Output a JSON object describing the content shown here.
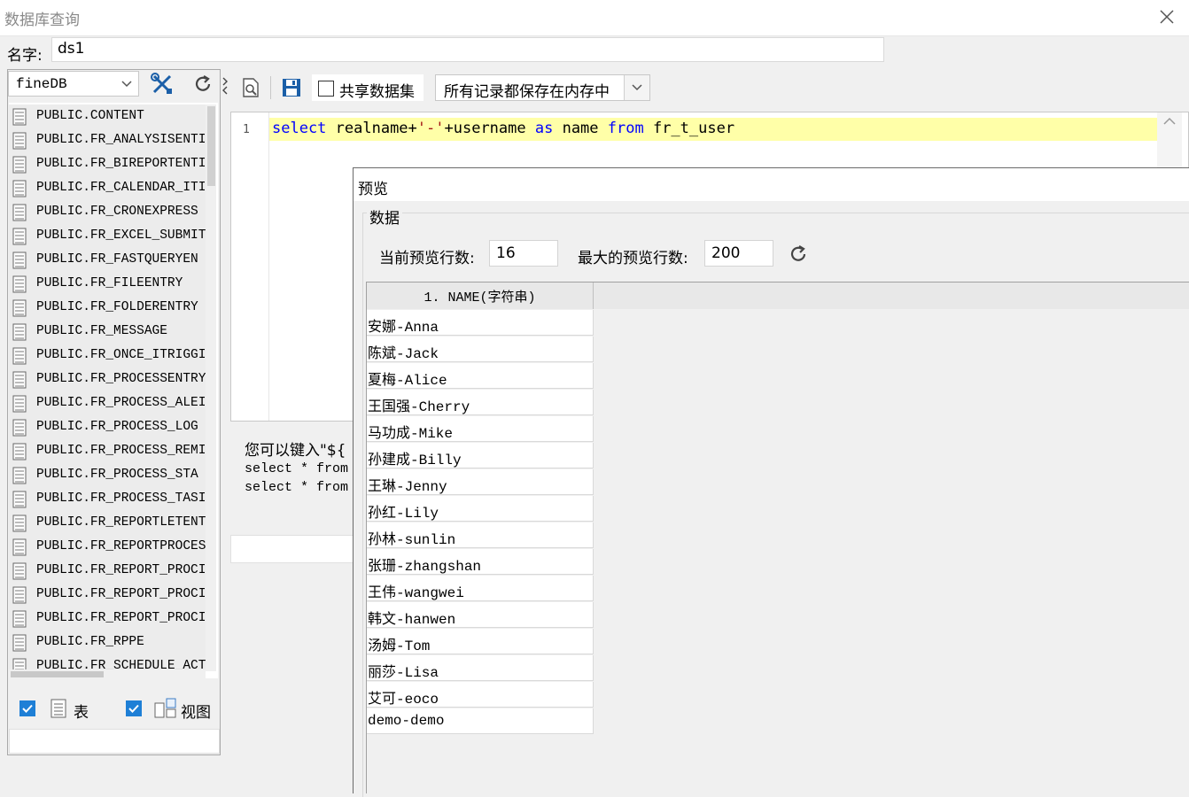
{
  "window": {
    "title": "数据库查询"
  },
  "name_field": {
    "label": "名字:",
    "value": "ds1"
  },
  "left_panel": {
    "db_select": "fineDB",
    "tables": [
      "PUBLIC.CONTENT",
      "PUBLIC.FR_ANALYSISENTI",
      "PUBLIC.FR_BIREPORTENTI",
      "PUBLIC.FR_CALENDAR_ITI",
      "PUBLIC.FR_CRONEXPRESS",
      "PUBLIC.FR_EXCEL_SUBMIT",
      "PUBLIC.FR_FASTQUERYEN",
      "PUBLIC.FR_FILEENTRY",
      "PUBLIC.FR_FOLDERENTRY",
      "PUBLIC.FR_MESSAGE",
      "PUBLIC.FR_ONCE_ITRIGGI",
      "PUBLIC.FR_PROCESSENTRY",
      "PUBLIC.FR_PROCESS_ALEI",
      "PUBLIC.FR_PROCESS_LOG",
      "PUBLIC.FR_PROCESS_REMI",
      "PUBLIC.FR_PROCESS_STA",
      "PUBLIC.FR_PROCESS_TASI",
      "PUBLIC.FR_REPORTLETENT",
      "PUBLIC.FR_REPORTPROCES",
      "PUBLIC.FR_REPORT_PROCI",
      "PUBLIC.FR_REPORT_PROCI",
      "PUBLIC.FR_REPORT_PROCI",
      "PUBLIC.FR_RPPE",
      "PUBLIC.FR_SCHEDULE_ACT"
    ],
    "table_checkbox_label": "表",
    "view_checkbox_label": "视图"
  },
  "toolbar": {
    "share_dataset_label": "共享数据集",
    "storage_mode": "所有记录都保存在内存中"
  },
  "editor": {
    "line_number": "1",
    "sql": {
      "select": "select",
      "part1": " realname+",
      "str": "'-'",
      "part2": "+username ",
      "as": "as",
      "part3": " name ",
      "from": "from",
      "part4": " fr_t_user"
    }
  },
  "hint": {
    "text": "您可以键入\"${",
    "line1": "select * from",
    "line2": "select * from"
  },
  "preview": {
    "title": "预览",
    "group_label": "数据",
    "current_rows_label": "当前预览行数:",
    "current_rows": "16",
    "max_rows_label": "最大的预览行数:",
    "max_rows": "200",
    "column_header": "1. NAME(字符串)",
    "rows": [
      "安娜-Anna",
      "陈斌-Jack",
      "夏梅-Alice",
      "王国强-Cherry",
      "马功成-Mike",
      "孙建成-Billy",
      "王琳-Jenny",
      "孙红-Lily",
      "孙林-sunlin",
      "张珊-zhangshan",
      "王伟-wangwei",
      "韩文-hanwen",
      "汤姆-Tom",
      "丽莎-Lisa",
      "艾可-eoco",
      "demo-demo"
    ]
  },
  "colors": {
    "accent": "#1e7fd6",
    "highlight_line": "#ffffa8",
    "keyword": "#0000ff",
    "string": "#a31515"
  }
}
